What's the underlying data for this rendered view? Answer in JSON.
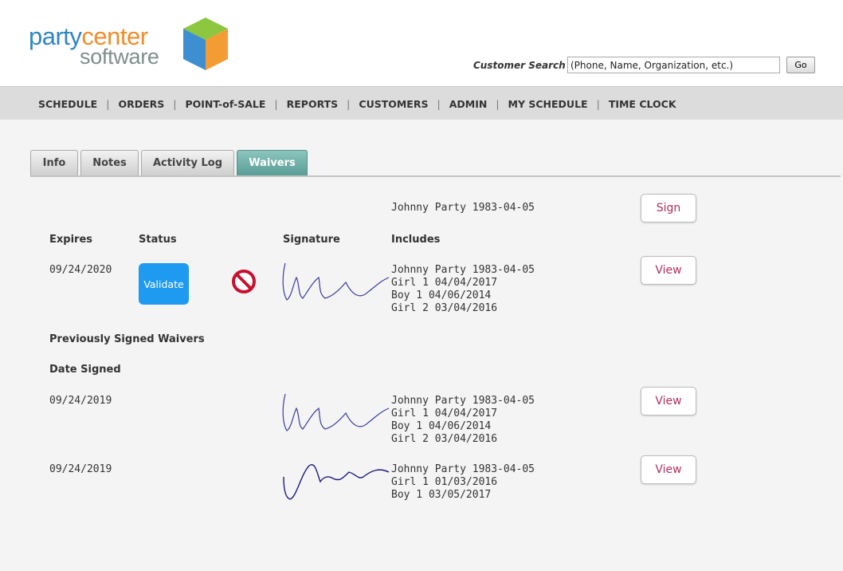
{
  "brand": {
    "line1_a": "party",
    "line1_b": "center",
    "line2": "software"
  },
  "search": {
    "label": "Customer Search",
    "placeholder": "(Phone, Name, Organization, etc.)",
    "go_label": "Go"
  },
  "nav": [
    "SCHEDULE",
    "ORDERS",
    "POINT-of-SALE",
    "REPORTS",
    "CUSTOMERS",
    "ADMIN",
    "MY SCHEDULE",
    "TIME CLOCK"
  ],
  "tabs": [
    "Info",
    "Notes",
    "Activity Log",
    "Waivers"
  ],
  "active_tab": "Waivers",
  "sign_row": {
    "person": "Johnny Party 1983-04-05",
    "button": "Sign"
  },
  "columns": {
    "expires": "Expires",
    "status": "Status",
    "signature": "Signature",
    "includes": "Includes"
  },
  "current_waiver": {
    "expires": "09/24/2020",
    "validate_label": "Validate",
    "includes": [
      "Johnny Party 1983-04-05",
      "Girl 1 04/04/2017",
      "Boy 1 04/06/2014",
      "Girl 2 03/04/2016"
    ],
    "view_label": "View"
  },
  "previous": {
    "title": "Previously Signed Waivers",
    "date_header": "Date Signed",
    "rows": [
      {
        "date": "09/24/2019",
        "includes": [
          "Johnny Party 1983-04-05",
          "Girl 1 04/04/2017",
          "Boy 1 04/06/2014",
          "Girl 2 03/04/2016"
        ],
        "view_label": "View"
      },
      {
        "date": "09/24/2019",
        "includes": [
          "Johnny Party 1983-04-05",
          "Girl 1 01/03/2016",
          "Boy 1 03/05/2017"
        ],
        "view_label": "View"
      }
    ]
  },
  "colors": {
    "accent_tab": "#5a9e96",
    "validate": "#1e9bf0",
    "button_text": "#b0305f",
    "nav_bg": "#dcdcdc"
  },
  "icons": {
    "status_not_valid": "no-entry-icon"
  }
}
